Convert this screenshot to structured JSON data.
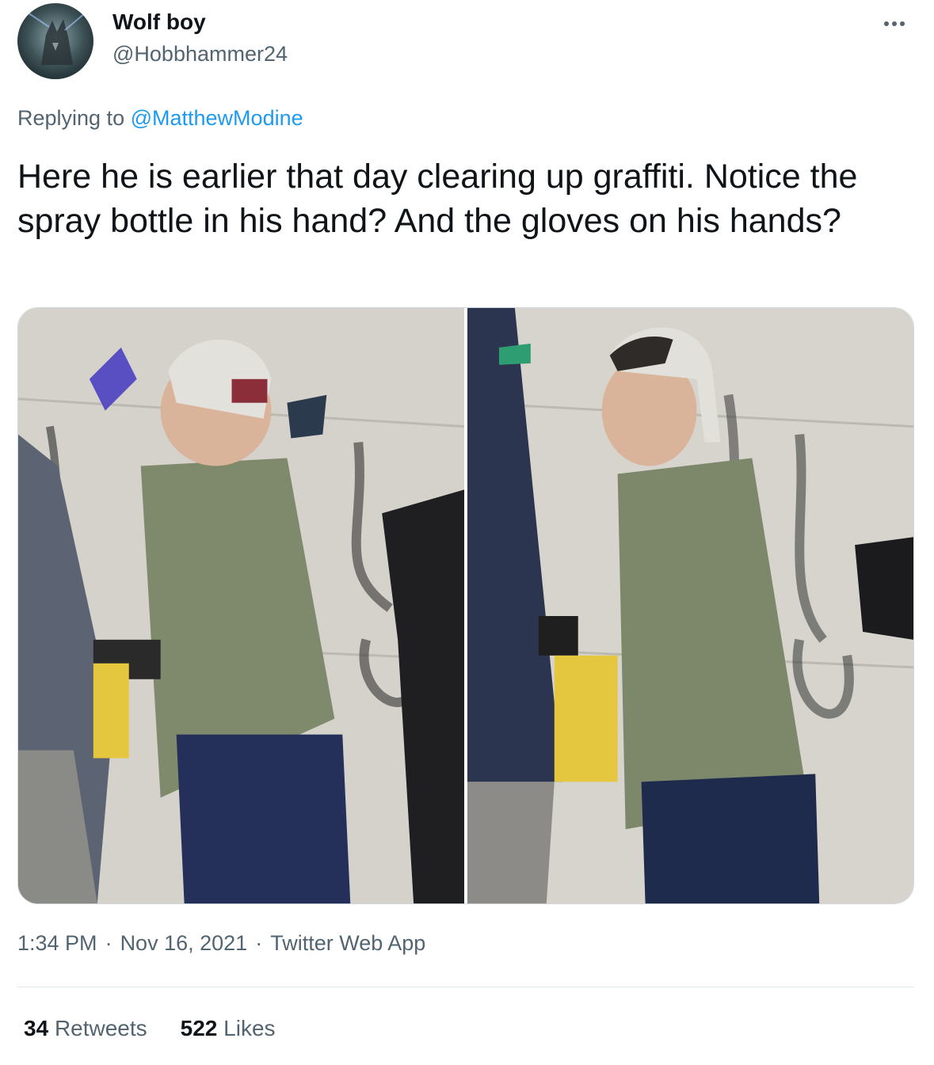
{
  "user": {
    "display_name": "Wolf boy",
    "handle": "@Hobbhammer24"
  },
  "reply": {
    "prefix": "Replying to",
    "mention": "@MatthewModine"
  },
  "tweet": {
    "text": "Here he is earlier that day clearing up graffiti. Notice the spray bottle in his hand? And the gloves on his hands?"
  },
  "meta": {
    "time": "1:34 PM",
    "date": "Nov 16, 2021",
    "source": "Twitter Web App"
  },
  "stats": {
    "retweets_count": "34",
    "retweets_label": "Retweets",
    "likes_count": "522",
    "likes_label": "Likes"
  },
  "icons": {
    "more": "more-horizontal-icon"
  },
  "colors": {
    "link": "#1d9bf0",
    "secondary_text": "#536471",
    "primary_text": "#0f1419"
  }
}
